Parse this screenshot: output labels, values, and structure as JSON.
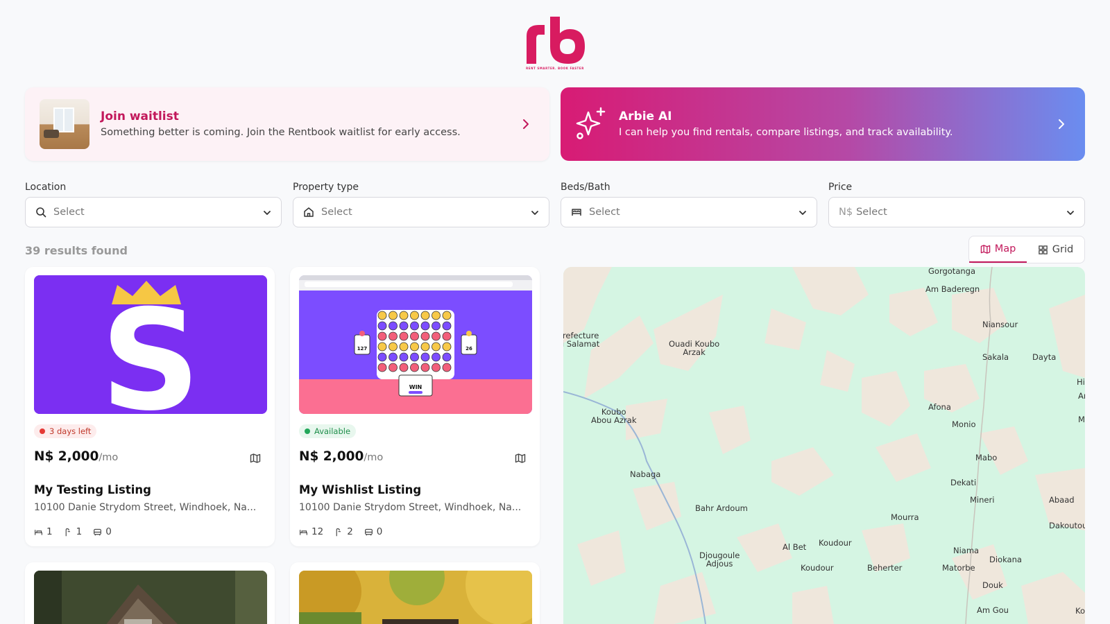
{
  "brand": {
    "tagline": "RENT SMARTER. BOOK FASTER",
    "color": "#d81b60"
  },
  "banners": {
    "waitlist": {
      "title": "Join waitlist",
      "text": "Something better is coming. Join the Rentbook waitlist for early access."
    },
    "ai": {
      "title": "Arbie AI",
      "text": "I can help you find rentals, compare listings, and track availability."
    }
  },
  "filters": {
    "location": {
      "label": "Location",
      "placeholder": "Select"
    },
    "property_type": {
      "label": "Property type",
      "placeholder": "Select"
    },
    "beds_bath": {
      "label": "Beds/Bath",
      "placeholder": "Select"
    },
    "price": {
      "label": "Price",
      "prefix": "N$",
      "placeholder": "Select"
    }
  },
  "results": {
    "count_text": "39 results found"
  },
  "view_toggle": {
    "map_label": "Map",
    "grid_label": "Grid",
    "active": "Map"
  },
  "listings": [
    {
      "status": "3 days left",
      "status_type": "warn",
      "price": "N$ 2,000",
      "period": "/mo",
      "title": "My Testing Listing",
      "address": "10100 Danie Strydom Street, Windhoek, Na...",
      "beds": "1",
      "baths": "1",
      "parking": "0"
    },
    {
      "status": "Available",
      "status_type": "ok",
      "price": "N$ 2,000",
      "period": "/mo",
      "title": "My Wishlist Listing",
      "address": "10100 Danie Strydom Street, Windhoek, Na...",
      "beds": "12",
      "baths": "2",
      "parking": "0"
    }
  ],
  "game_preview": {
    "score_left": "127",
    "score_right": "26",
    "result": "WIN"
  },
  "map": {
    "labels": [
      {
        "text": "Gorgotanga"
      },
      {
        "text": "Am Baderegn"
      },
      {
        "text": "Niansour"
      },
      {
        "text": "refecture\ni Salamat"
      },
      {
        "text": "Ouadi Koubo\nArzak"
      },
      {
        "text": "Sakala"
      },
      {
        "text": "Dayta"
      },
      {
        "text": "Hidjelid"
      },
      {
        "text": "Am Mal"
      },
      {
        "text": "Koubo\nAbou Azrak"
      },
      {
        "text": "Afona"
      },
      {
        "text": "Monio"
      },
      {
        "text": "Mabo"
      },
      {
        "text": "Nabaga"
      },
      {
        "text": "Mabo"
      },
      {
        "text": "Dekati"
      },
      {
        "text": "Mineri"
      },
      {
        "text": "Abaad"
      },
      {
        "text": "Bahr Ardoum"
      },
      {
        "text": "Mourra"
      },
      {
        "text": "Dakoutour"
      },
      {
        "text": "Koudour"
      },
      {
        "text": "Al Bet"
      },
      {
        "text": "Niama"
      },
      {
        "text": "Djougoule\nAdjous"
      },
      {
        "text": "Diokana"
      },
      {
        "text": "Koudour"
      },
      {
        "text": "Beherter"
      },
      {
        "text": "Matorbe"
      },
      {
        "text": "Douk"
      },
      {
        "text": "Am Gou"
      },
      {
        "text": "Kosa"
      }
    ]
  }
}
